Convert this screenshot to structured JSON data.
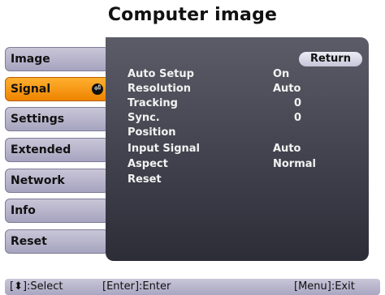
{
  "header": {
    "title": "Computer image"
  },
  "menu": {
    "items": [
      {
        "label": "Image"
      },
      {
        "label": "Signal",
        "active": true
      },
      {
        "label": "Settings"
      },
      {
        "label": "Extended"
      },
      {
        "label": "Network"
      },
      {
        "label": "Info"
      },
      {
        "label": "Reset"
      }
    ],
    "active_enter_icon": "enter-icon"
  },
  "panel": {
    "return_label": "Return",
    "rows": [
      {
        "label": "Auto Setup",
        "value": "On"
      },
      {
        "label": "Resolution",
        "value": "Auto"
      },
      {
        "label": "Tracking",
        "value": "0"
      },
      {
        "label": "Sync.",
        "value": "0"
      },
      {
        "label": "Position",
        "value": ""
      },
      {
        "label": "Input Signal",
        "value": "Auto"
      },
      {
        "label": "Aspect",
        "value": "Normal"
      },
      {
        "label": "Reset",
        "value": ""
      }
    ]
  },
  "footer": {
    "select_hint": "[⬍]:Select",
    "enter_hint": "[Enter]:Enter",
    "exit_hint": "[Menu]:Exit"
  },
  "colors": {
    "active_item": "#ee8300",
    "menu_item": "#b8b5cc",
    "panel": "#45454f"
  }
}
